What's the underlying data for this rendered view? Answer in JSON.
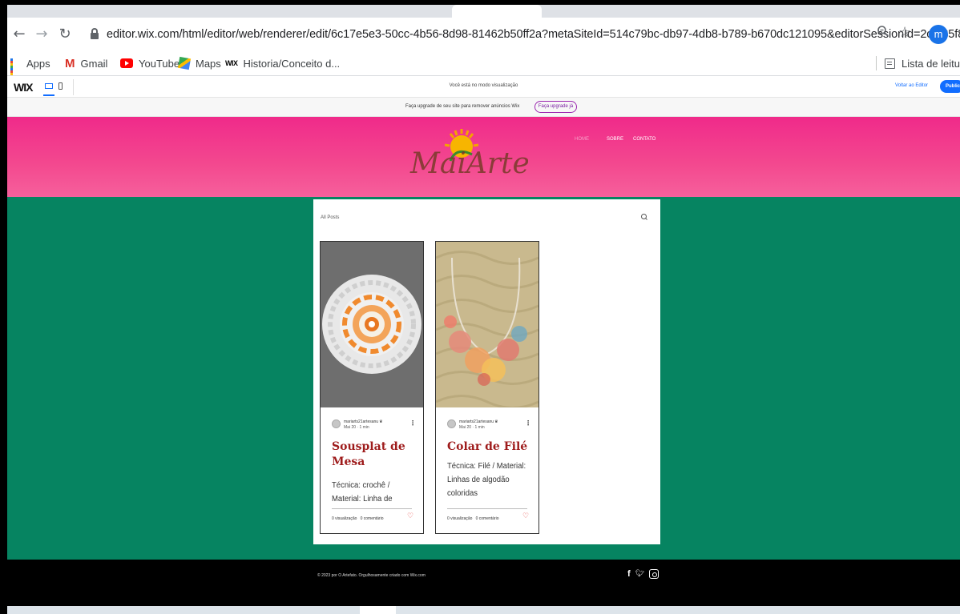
{
  "browser": {
    "url": "editor.wix.com/html/editor/web/renderer/edit/6c17e5e3-50cc-4b56-8d98-81462b50ff2a?metaSiteId=514c79bc-db97-4db8-b789-b670dc121095&editorSessionId=2cf535f8...",
    "profile_initial": "m",
    "bookmarks": [
      "Apps",
      "Gmail",
      "YouTube",
      "Maps",
      "Historia/Conceito d..."
    ],
    "reading_list": "Lista de leitu"
  },
  "wix_bar": {
    "logo": "WIX",
    "preview_message": "Você está no modo visualização",
    "back_to_editor": "Voltar ao Editor",
    "publish": "Public"
  },
  "upgrade_banner": {
    "text": "Faça upgrade de seu site para remover anúncios Wix",
    "button": "Faça upgrade já"
  },
  "site": {
    "logo_text": "MaiArtes",
    "nav": [
      "HOME",
      "SOBRE",
      "CONTATO"
    ],
    "all_posts": "All Posts",
    "posts": [
      {
        "author": "mariarts21artesanu",
        "date": "Mai 20 · 1 min",
        "title": "Sousplat de Mesa",
        "excerpt": "Técnica: crochê / Material: Linha de",
        "views": "0 visualização",
        "comments": "0 comentário"
      },
      {
        "author": "mariarts21artesanu",
        "date": "Mai 20 · 1 min",
        "title": "Colar de Filé",
        "excerpt": "Técnica: Filé / Material: Linhas de algodão coloridas",
        "views": "0 visualização",
        "comments": "0 comentário"
      }
    ],
    "footer_text": "© 2023 por O Artefato. Orgulhosamente criado com Wix.com"
  },
  "colors": {
    "header_pink": "#f02a8a",
    "body_green": "#068461",
    "title_red": "#9e1b1b",
    "wix_blue": "#116dff"
  }
}
